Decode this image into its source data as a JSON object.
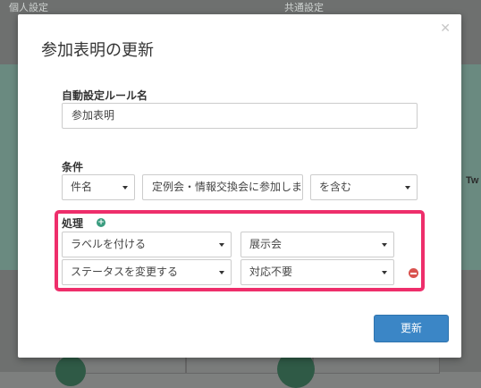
{
  "background": {
    "tab_left": "個人設定",
    "tab_right": "共通設定",
    "side_text": "Tw"
  },
  "dialog": {
    "title": "参加表明の更新",
    "close_icon": "close-icon",
    "rule_name": {
      "label": "自動設定ルール名",
      "value": "参加表明"
    },
    "condition": {
      "label": "条件",
      "field": "件名",
      "keyword": "定例会・情報交換会に参加しま",
      "operator": "を含む"
    },
    "actions": {
      "label": "処理",
      "add_icon": "plus-circle-icon",
      "rows": [
        {
          "action": "ラベルを付ける",
          "value": "展示会"
        },
        {
          "action": "ステータスを変更する",
          "value": "対応不要",
          "remove_icon": "minus-circle-icon"
        }
      ],
      "highlight_color": "#ee2e6b"
    },
    "submit_label": "更新",
    "accent_color": "#3b86c6"
  }
}
